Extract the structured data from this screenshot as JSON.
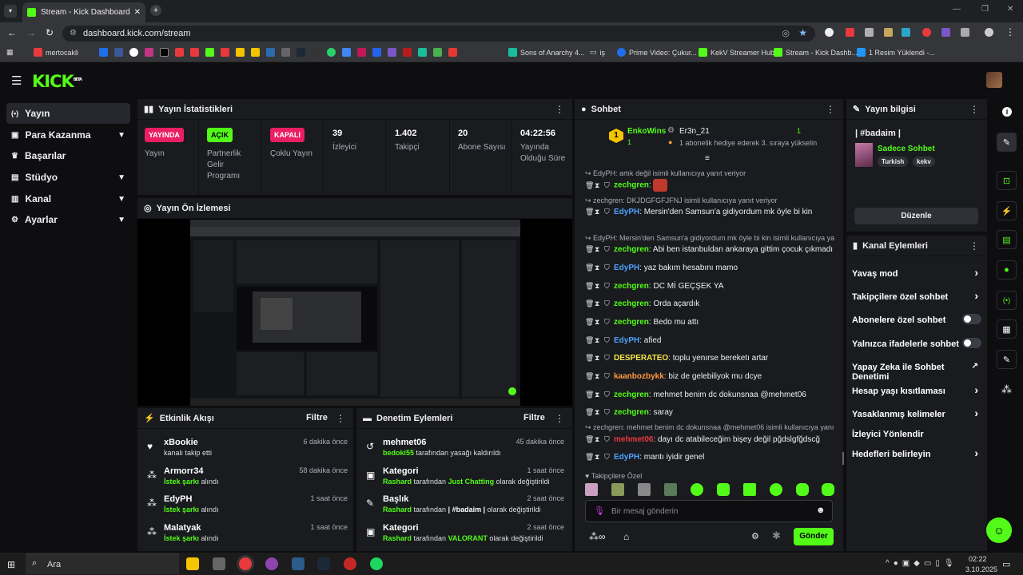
{
  "browser": {
    "tab_title": "Stream - Kick Dashboard",
    "url": "dashboard.kick.com/stream",
    "bookmarks": [
      "mertocakli",
      "Sons of Anarchy 4...",
      "iş",
      "Prime Video: Çukur...",
      "KekV Streamer Hub",
      "Stream - Kick Dashb...",
      "1 Resim Yüklendi -..."
    ]
  },
  "sidebar": {
    "items": [
      {
        "label": "Yayın",
        "icon": "broadcast-icon"
      },
      {
        "label": "Para Kazanma",
        "icon": "money-icon"
      },
      {
        "label": "Başarılar",
        "icon": "trophy-icon"
      },
      {
        "label": "Stüdyo",
        "icon": "studio-icon"
      },
      {
        "label": "Kanal",
        "icon": "channel-icon"
      },
      {
        "label": "Ayarlar",
        "icon": "gear-icon"
      }
    ]
  },
  "stats": {
    "title": "Yayın İstatistikleri",
    "items": [
      {
        "badge": "YAYINDA",
        "label": "Yayın"
      },
      {
        "badge": "AÇIK",
        "label": "Partnerlik Gelir Programı"
      },
      {
        "badge": "KAPALI",
        "label": "Çoklu Yayın"
      },
      {
        "value": "39",
        "label": "İzleyici"
      },
      {
        "value": "1.402",
        "label": "Takipçi"
      },
      {
        "value": "20",
        "label": "Abone Sayısı"
      },
      {
        "value": "04:22:56",
        "label": "Yayında Olduğu Süre"
      }
    ]
  },
  "preview": {
    "title": "Yayın Ön İzlemesi"
  },
  "activity": {
    "title": "Etkinlik Akışı",
    "filter": "Filtre",
    "items": [
      {
        "name": "xBookie",
        "time": "6 dakika önce",
        "sub": "kanalı takip etti"
      },
      {
        "name": "Armorr34",
        "time": "58 dakika önce",
        "sub_green": "İstek şarkı",
        "sub": " alındı"
      },
      {
        "name": "EdyPH",
        "time": "1 saat önce",
        "sub_green": "İstek şarkı",
        "sub": " alındı"
      },
      {
        "name": "Malatyak",
        "time": "1 saat önce",
        "sub_green": "İstek şarkı",
        "sub": " alındı"
      }
    ]
  },
  "moderation": {
    "title": "Denetim Eylemleri",
    "filter": "Filtre",
    "items": [
      {
        "name": "mehmet06",
        "time": "45 dakika önce",
        "actor": "bedoki55",
        "sub": " tarafından yasağı kaldırıldı"
      },
      {
        "name": "Kategori",
        "time": "1 saat önce",
        "actor": "Rashard",
        "sub": " tarafından ",
        "hl": "Just Chatting",
        "sub2": " olarak değiştirildi"
      },
      {
        "name": "Başlık",
        "time": "2 saat önce",
        "actor": "Rashard",
        "sub": " tarafından ",
        "hl": "| #badaim |",
        "sub2": " olarak değiştirildi"
      },
      {
        "name": "Kategori",
        "time": "2 saat önce",
        "actor": "Rashard",
        "sub": " tarafından ",
        "hl": "VALORANT",
        "sub2": " olarak değiştirildi"
      }
    ]
  },
  "chat": {
    "title": "Sohbet",
    "pinned_user": "EnkoWins",
    "pinned_count": "1",
    "gifter": "Er3n_21",
    "gifter_count": "1",
    "gift_text": "1 abonelik hediye ederek 3. sıraya yükselin",
    "messages": [
      {
        "reply": "EdyPH: artık değil isimli kullanıcıya yanıt veriyor"
      },
      {
        "user": "zechgren",
        "color": "#53fc18",
        "text": ""
      },
      {
        "reply": "zechgren: DKJDGFGFJFNJ isimli kullanıcıya yanıt veriyor"
      },
      {
        "user": "EdyPH",
        "color": "#4fa3ff",
        "text": "Mersin'den Samsun'a gidiyordum mk öyle bi kin"
      },
      {
        "reply": "EdyPH: Mersin'den Samsun'a gidiyordum mk öyle bi kin isimli kullanıcıya yanıt..."
      },
      {
        "user": "zechgren",
        "color": "#53fc18",
        "text": "Abi ben istanbuldan ankaraya gittim çocuk çıkmadı"
      },
      {
        "user": "EdyPH",
        "color": "#4fa3ff",
        "text": "yaz bakım hesabını mamo"
      },
      {
        "user": "zechgren",
        "color": "#53fc18",
        "text": "DC Mİ GEÇŞEK YA"
      },
      {
        "user": "zechgren",
        "color": "#53fc18",
        "text": "Orda açardık"
      },
      {
        "user": "zechgren",
        "color": "#53fc18",
        "text": "Bedo mu attı"
      },
      {
        "user": "EdyPH",
        "color": "#4fa3ff",
        "text": "afied"
      },
      {
        "user": "DESPERATEO",
        "color": "#f5e642",
        "text": "toplu yenırse bereketı artar"
      },
      {
        "user": "kaanbozbykk",
        "color": "#ff9a3c",
        "text": "biz de gelebiliyok mu dcye"
      },
      {
        "user": "zechgren",
        "color": "#53fc18",
        "text": "mehmet benim dc dokunsnaa @mehmet06"
      },
      {
        "user": "zechgren",
        "color": "#53fc18",
        "text": "saray"
      },
      {
        "reply": "zechgren: mehmet benim dc dokunsnaa @mehmet06 isimli kullanıcıya yanıt..."
      },
      {
        "user": "mehmet06",
        "color": "#e8393c",
        "text": "dayı dc atabileceğim bişey değil pğdslgfğdscğ"
      },
      {
        "user": "EdyPH",
        "color": "#4fa3ff",
        "text": "mantı iyidir genel"
      }
    ],
    "followers_only": "Takipçilere Özel",
    "input_placeholder": "Bir mesaj gönderin",
    "send_label": "Gönder"
  },
  "stream_info": {
    "title": "Yayın bilgisi",
    "stream_title": "| #badaim |",
    "category": "Sadece Sohbet",
    "tags": [
      "Turkish",
      "kekv"
    ],
    "edit_label": "Düzenle"
  },
  "channel_actions": {
    "title": "Kanal Eylemleri",
    "items": [
      {
        "label": "Yavaş mod",
        "control": "chevron"
      },
      {
        "label": "Takipçilere özel sohbet",
        "control": "chevron"
      },
      {
        "label": "Abonelere özel sohbet",
        "control": "toggle"
      },
      {
        "label": "Yalnızca ifadelerle sohbet",
        "control": "toggle"
      },
      {
        "label": "Yapay Zeka ile Sohbet Denetimi",
        "control": "external"
      },
      {
        "label": "Hesap yaşı kısıtlaması",
        "control": "chevron"
      },
      {
        "label": "Yasaklanmış kelimeler",
        "control": "chevron"
      },
      {
        "label": "İzleyici Yönlendir",
        "control": "none"
      },
      {
        "label": "Hedefleri belirleyin",
        "control": "chevron"
      }
    ]
  },
  "taskbar": {
    "search": "Ara",
    "time": "02:22",
    "date": "3.10.2025"
  },
  "colors": {
    "accent": "#53fc18",
    "live": "#e91e63",
    "panel": "#191b1f"
  }
}
